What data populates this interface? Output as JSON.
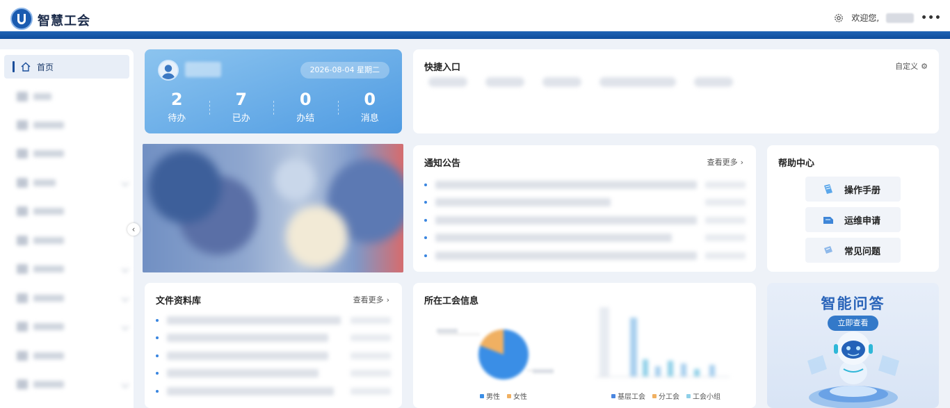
{
  "header": {
    "brand": "智慧工会",
    "welcome": "欢迎您,",
    "more": "•••"
  },
  "sidebar": {
    "home_label": "首页"
  },
  "profile": {
    "date": "2026-08-04 星期二",
    "stats": [
      {
        "value": "2",
        "label": "待办"
      },
      {
        "value": "7",
        "label": "已办"
      },
      {
        "value": "0",
        "label": "办结"
      },
      {
        "value": "0",
        "label": "消息"
      }
    ]
  },
  "quick": {
    "title": "快捷入口",
    "custom": "自定义"
  },
  "notice": {
    "title": "通知公告",
    "more": "查看更多"
  },
  "help": {
    "title": "帮助中心",
    "items": [
      "操作手册",
      "运维申请",
      "常见问题"
    ]
  },
  "files": {
    "title": "文件资料库",
    "more": "查看更多"
  },
  "union": {
    "title": "所在工会信息",
    "gender_legend": [
      "男性",
      "女性"
    ],
    "org_legend": [
      "基层工会",
      "分工会",
      "工会小组"
    ]
  },
  "ai": {
    "title": "智能问答",
    "button": "立即查看"
  },
  "colors": {
    "brand_blue": "#1f63b5",
    "accent": "#3a86e0",
    "male": "#3a8ee6",
    "female": "#f0b062",
    "level_basic": "#4a86e0",
    "level_branch": "#f0b062",
    "level_group": "#8fd0e8"
  }
}
